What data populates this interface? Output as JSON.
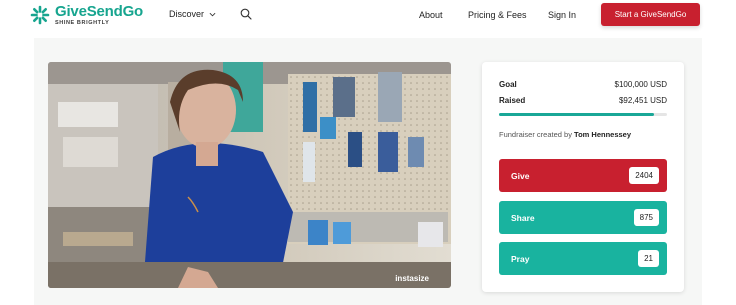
{
  "brand": {
    "name": "GiveSendGo",
    "tagline": "SHINE BRIGHTLY",
    "accent": "#17a58f",
    "primary": "#c8202f"
  },
  "nav": {
    "discover": "Discover",
    "about": "About",
    "pricing": "Pricing & Fees",
    "signin": "Sign In",
    "start": "Start a GiveSendGo"
  },
  "photo": {
    "watermark": "instasize"
  },
  "campaign": {
    "goal_label": "Goal",
    "goal_value": "$100,000 USD",
    "raised_label": "Raised",
    "raised_value": "$92,451 USD",
    "progress": 0.92451,
    "creator_prefix": "Fundraiser created by",
    "creator_name": "Tom Hennessey"
  },
  "actions": {
    "give": {
      "label": "Give",
      "count": "2404"
    },
    "share": {
      "label": "Share",
      "count": "875"
    },
    "pray": {
      "label": "Pray",
      "count": "21"
    }
  }
}
